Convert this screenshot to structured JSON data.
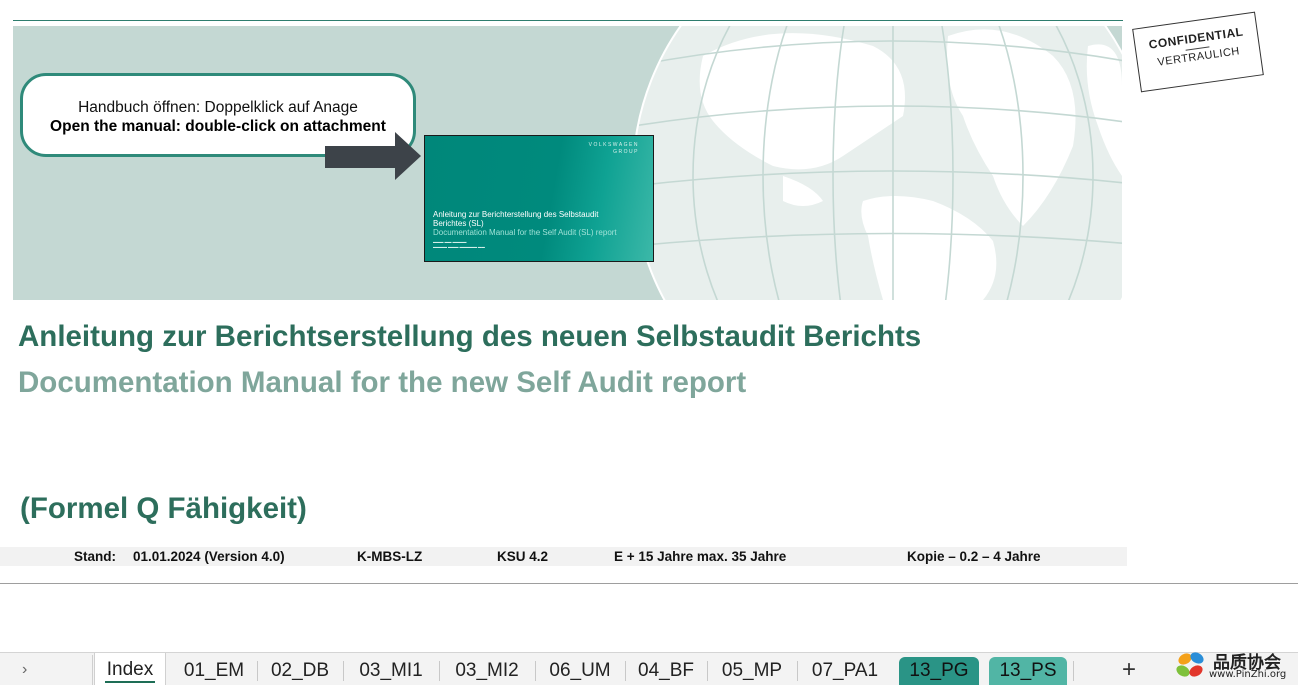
{
  "banner": {
    "callout_de": "Handbuch öffnen: Doppelklick auf Anage",
    "callout_en": "Open the manual: double-click on attachment",
    "attachment": {
      "brand_line1": "VOLKSWAGEN",
      "brand_line2": "GROUP",
      "title_de": "Anleitung zur Berichterstellung des Selbstaudit Berichtes (SL)",
      "title_en": "Documentation Manual for the Self Audit (SL) report"
    }
  },
  "stamp": {
    "line1": "CONFIDENTIAL",
    "line2": "VERTRAULICH"
  },
  "document": {
    "title_de": "Anleitung zur Berichtserstellung des neuen Selbstaudit Berichts",
    "title_en": "Documentation Manual for the new Self Audit report",
    "subtitle": "(Formel Q Fähigkeit)",
    "status": {
      "stand_label": "Stand:",
      "date_version": "01.01.2024  (Version 4.0)",
      "code": "K-MBS-LZ",
      "ksu": "KSU 4.2",
      "retention": "E + 15 Jahre max. 35 Jahre",
      "copy": "Kopie – 0.2 – 4 Jahre"
    }
  },
  "sheet_tabs": {
    "nav_icon": "chevron-right",
    "tabs": [
      "Index",
      "01_EM",
      "02_DB",
      "03_MI1",
      "03_MI2",
      "06_UM",
      "04_BF",
      "05_MP",
      "07_PA1",
      "13_PG",
      "13_PS"
    ],
    "add_label": "+"
  },
  "watermark": {
    "cn": "品质协会",
    "url": "www.PinZhi.org"
  },
  "colors": {
    "accent": "#2d6e5c",
    "banner_bg": "#c4d8d3",
    "tab_green": "#2a9486",
    "tab_green_light": "#51b5a5"
  }
}
